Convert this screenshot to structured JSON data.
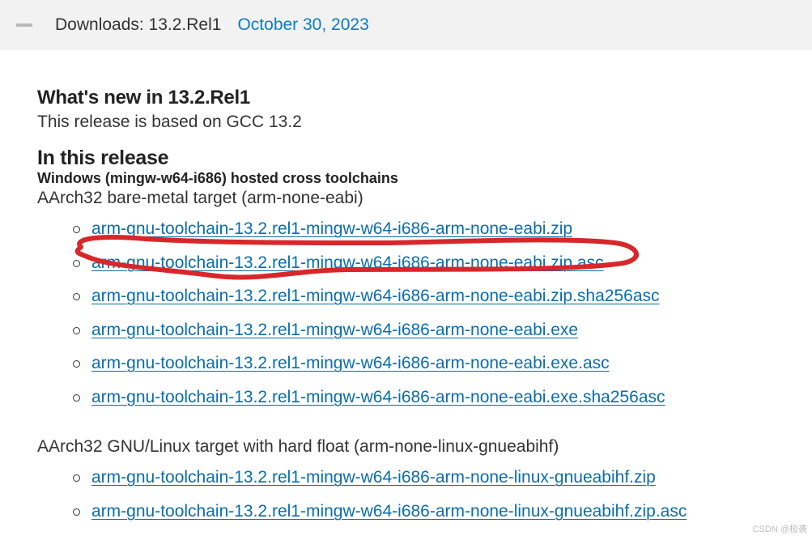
{
  "header": {
    "title": "Downloads: 13.2.Rel1",
    "date": "October 30, 2023"
  },
  "sections": {
    "whats_new_title": "What's new in 13.2.Rel1",
    "based_on": "This release is based on GCC 13.2",
    "in_release_title": "In this release",
    "host_title": "Windows (mingw-w64-i686) hosted cross toolchains",
    "target1": "AArch32 bare-metal target (arm-none-eabi)",
    "target2": "AArch32 GNU/Linux target with hard float (arm-none-linux-gnueabihf)"
  },
  "files1": [
    "arm-gnu-toolchain-13.2.rel1-mingw-w64-i686-arm-none-eabi.zip",
    "arm-gnu-toolchain-13.2.rel1-mingw-w64-i686-arm-none-eabi.zip.asc",
    "arm-gnu-toolchain-13.2.rel1-mingw-w64-i686-arm-none-eabi.zip.sha256asc",
    "arm-gnu-toolchain-13.2.rel1-mingw-w64-i686-arm-none-eabi.exe",
    "arm-gnu-toolchain-13.2.rel1-mingw-w64-i686-arm-none-eabi.exe.asc",
    "arm-gnu-toolchain-13.2.rel1-mingw-w64-i686-arm-none-eabi.exe.sha256asc"
  ],
  "files2": [
    "arm-gnu-toolchain-13.2.rel1-mingw-w64-i686-arm-none-linux-gnueabihf.zip",
    "arm-gnu-toolchain-13.2.rel1-mingw-w64-i686-arm-none-linux-gnueabihf.zip.asc"
  ],
  "watermark": "CSDN @极袭"
}
